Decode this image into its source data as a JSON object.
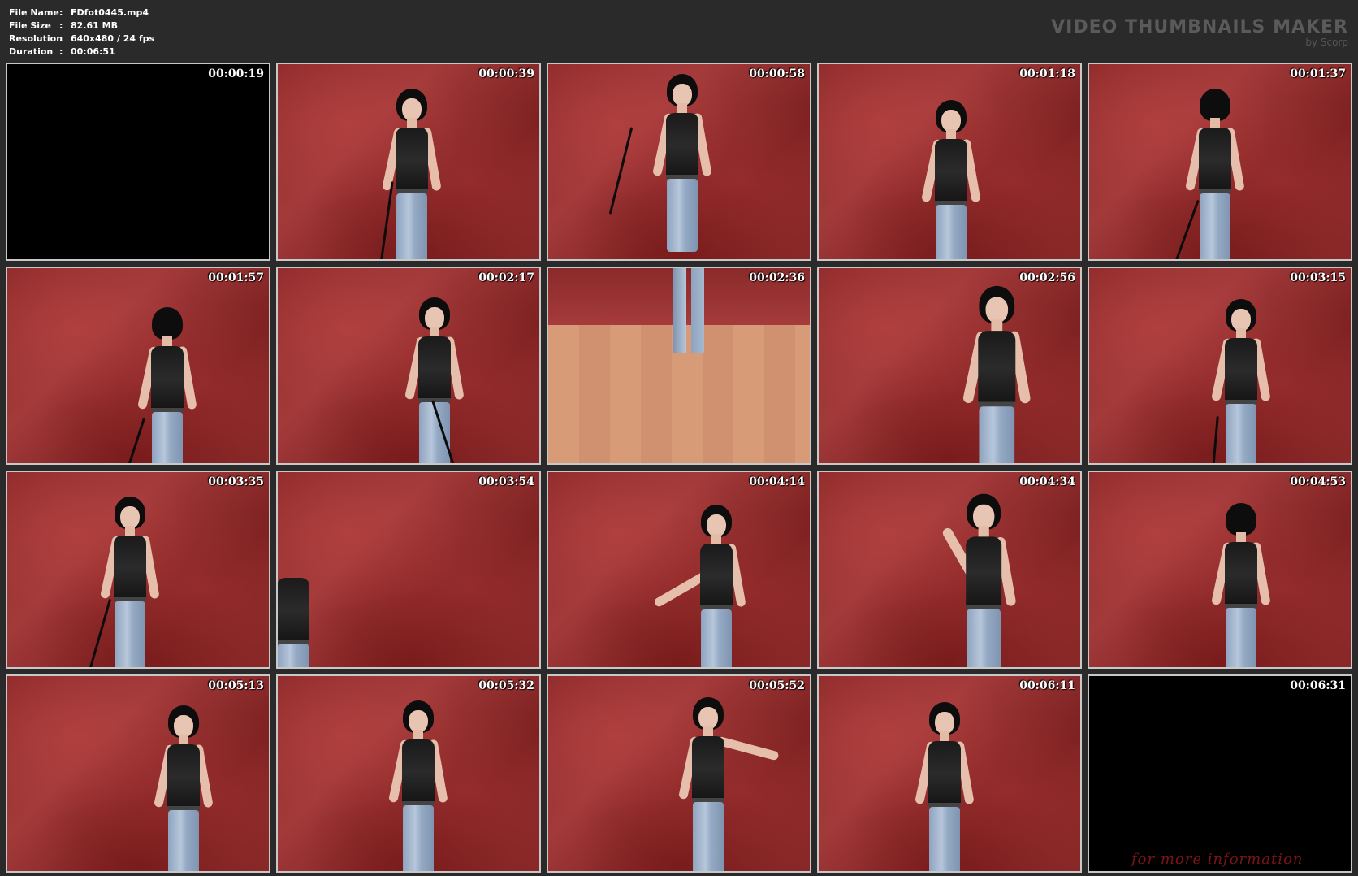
{
  "meta": {
    "file_name_label": "File Name",
    "file_name_value": "FDfot0445.mp4",
    "file_size_label": "File Size",
    "file_size_value": "82.61 MB",
    "resolution_label": "Resolution",
    "resolution_value": "640x480 / 24 fps",
    "duration_label": "Duration",
    "duration_value": "00:06:51",
    "separator": ":"
  },
  "brand": {
    "title": "VIDEO THUMBNAILS MAKER",
    "subtitle": "by Scorp"
  },
  "thumbnails": [
    {
      "timestamp": "00:00:19"
    },
    {
      "timestamp": "00:00:39"
    },
    {
      "timestamp": "00:00:58"
    },
    {
      "timestamp": "00:01:18"
    },
    {
      "timestamp": "00:01:37"
    },
    {
      "timestamp": "00:01:57"
    },
    {
      "timestamp": "00:02:17"
    },
    {
      "timestamp": "00:02:36"
    },
    {
      "timestamp": "00:02:56"
    },
    {
      "timestamp": "00:03:15"
    },
    {
      "timestamp": "00:03:35"
    },
    {
      "timestamp": "00:03:54"
    },
    {
      "timestamp": "00:04:14"
    },
    {
      "timestamp": "00:04:34"
    },
    {
      "timestamp": "00:04:53"
    },
    {
      "timestamp": "00:05:13"
    },
    {
      "timestamp": "00:05:32"
    },
    {
      "timestamp": "00:05:52"
    },
    {
      "timestamp": "00:06:11"
    },
    {
      "timestamp": "00:06:31",
      "overlay_text": "for more information"
    }
  ],
  "colors": {
    "page_background": "#2a2a2a",
    "frame_border": "#c8c8c8",
    "backdrop_red": "#8e2a2a",
    "brand_text": "#5a5a5a"
  }
}
